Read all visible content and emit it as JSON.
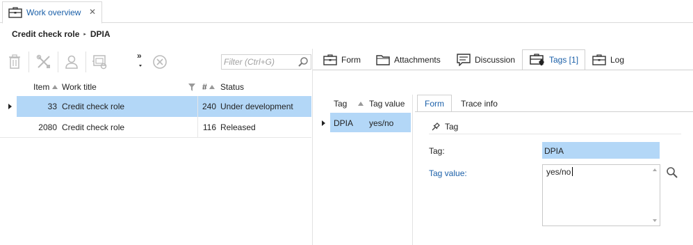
{
  "top_tab": {
    "label": "Work overview",
    "close": "✕"
  },
  "breadcrumb": {
    "parent": "Credit check role",
    "sep": "▸",
    "current": "DPIA"
  },
  "toolbar": {
    "filter_placeholder": "Filter (Ctrl+G)",
    "more": "»"
  },
  "grid": {
    "headers": {
      "item": "Item",
      "work_title": "Work title",
      "count": "#",
      "status": "Status"
    },
    "rows": [
      {
        "item": "33",
        "work_title": "Credit check role",
        "count": "240",
        "status": "Under development"
      },
      {
        "item": "2080",
        "work_title": "Credit check role",
        "count": "116",
        "status": "Released"
      }
    ]
  },
  "right_tabs": {
    "form": "Form",
    "attachments": "Attachments",
    "discussion": "Discussion",
    "tags": "Tags [1]",
    "log": "Log"
  },
  "tags_list": {
    "headers": {
      "tag": "Tag",
      "tag_value": "Tag value"
    },
    "rows": [
      {
        "tag": "DPIA",
        "tag_value": "yes/no"
      }
    ]
  },
  "form_tabs": {
    "form": "Form",
    "trace": "Trace info"
  },
  "form": {
    "section": "Tag",
    "tag_label": "Tag:",
    "tag_value": "DPIA",
    "tag_value_label": "Tag value:",
    "tag_value_text": "yes/no"
  },
  "colors": {
    "accent": "#1a5fa8",
    "selection": "#b3d7f7",
    "icon_gray": "#b8b8b8",
    "text": "#222222"
  }
}
